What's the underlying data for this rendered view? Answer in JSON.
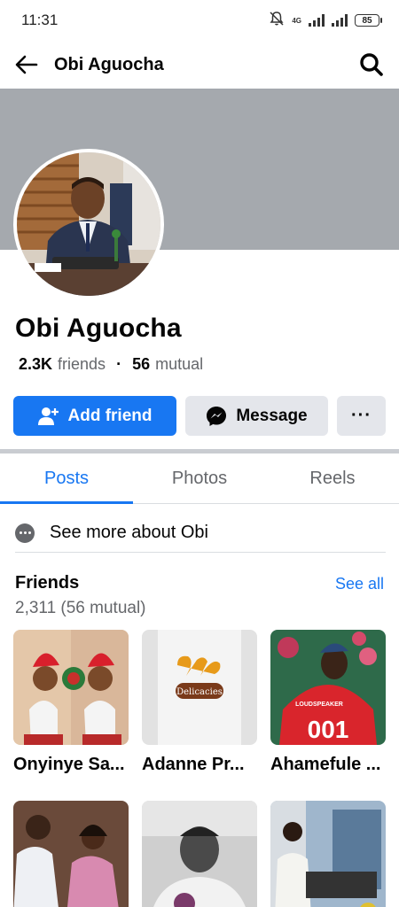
{
  "status_bar": {
    "time": "11:31",
    "network": "4G",
    "battery": "85",
    "icons": [
      "bell-muted-icon",
      "signal-icon",
      "signal-icon",
      "battery-icon"
    ]
  },
  "header": {
    "title": "Obi Aguocha",
    "back_icon": "arrow-left-icon",
    "search_icon": "search-icon"
  },
  "profile": {
    "name": "Obi Aguocha",
    "friends_count": "2.3K",
    "friends_label": "friends",
    "separator": "·",
    "mutual_count": "56",
    "mutual_label": "mutual"
  },
  "actions": {
    "add_friend": "Add friend",
    "message": "Message",
    "more": "···"
  },
  "tabs": [
    {
      "label": "Posts",
      "active": true
    },
    {
      "label": "Photos",
      "active": false
    },
    {
      "label": "Reels",
      "active": false
    }
  ],
  "about": {
    "see_more": "See more about Obi"
  },
  "friends": {
    "title": "Friends",
    "see_all": "See all",
    "count": "2,311 (56 mutual)",
    "items": [
      {
        "name": "Onyinye Sa..."
      },
      {
        "name": "Adanne Pr..."
      },
      {
        "name": "Ahamefule ..."
      },
      {
        "name": ""
      },
      {
        "name": ""
      },
      {
        "name": ""
      }
    ]
  },
  "brand_logo_text": "Delicacies",
  "colors": {
    "accent": "#1877f2",
    "cover": "#a5a9ae",
    "button_gray": "#e4e6eb",
    "secondary_text": "#65676b"
  }
}
